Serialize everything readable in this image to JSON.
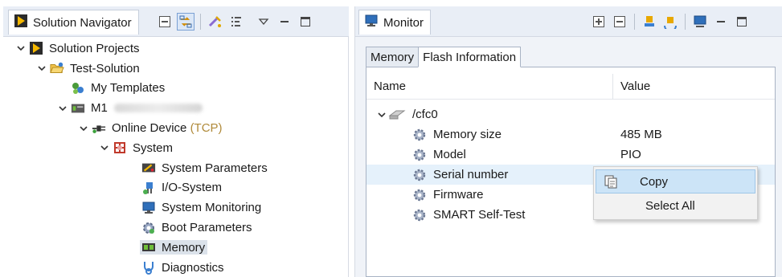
{
  "navigator": {
    "tab_label": "Solution Navigator",
    "toolbar": [
      "collapse-all-icon",
      "link-with-editor-icon",
      "filter-icon",
      "list-view-icon",
      "view-menu-icon",
      "minimize-icon",
      "maximize-icon"
    ],
    "tree": [
      {
        "label": "Solution Projects",
        "suffix": "",
        "icon": "solution-projects-icon",
        "level": 0,
        "expanded": true
      },
      {
        "label": "Test-Solution",
        "suffix": "",
        "icon": "folder-open-icon",
        "level": 1,
        "expanded": true
      },
      {
        "label": "My Templates",
        "suffix": "",
        "icon": "templates-icon",
        "level": 2,
        "expanded": null
      },
      {
        "label": "M1",
        "suffix": "",
        "icon": "device-module-icon",
        "level": 2,
        "expanded": true
      },
      {
        "label": "Online Device",
        "suffix": "(TCP)",
        "icon": "online-device-icon",
        "level": 3,
        "expanded": true
      },
      {
        "label": "System",
        "suffix": "",
        "icon": "system-icon",
        "level": 4,
        "expanded": true
      },
      {
        "label": "System Parameters",
        "suffix": "",
        "icon": "system-parameters-icon",
        "level": 5,
        "expanded": null
      },
      {
        "label": "I/O-System",
        "suffix": "",
        "icon": "io-system-icon",
        "level": 5,
        "expanded": null
      },
      {
        "label": "System Monitoring",
        "suffix": "",
        "icon": "monitor-icon",
        "level": 5,
        "expanded": null
      },
      {
        "label": "Boot Parameters",
        "suffix": "",
        "icon": "boot-gear-icon",
        "level": 5,
        "expanded": null
      },
      {
        "label": "Memory",
        "suffix": "",
        "icon": "memory-chip-icon",
        "level": 5,
        "expanded": null,
        "selected": true
      },
      {
        "label": "Diagnostics",
        "suffix": "",
        "icon": "diagnostics-icon",
        "level": 5,
        "expanded": null
      }
    ]
  },
  "monitor": {
    "tab_label": "Monitor",
    "toolbar": [
      "expand-all-icon",
      "collapse-all-icon",
      "connect-icon",
      "refresh-icon",
      "monitor-view-icon",
      "minimize-icon",
      "maximize-icon"
    ],
    "inner_tabs": [
      "Memory",
      "Flash Information"
    ],
    "active_inner_tab": 1,
    "columns": {
      "name": "Name",
      "value": "Value"
    },
    "rows": [
      {
        "name": "/cfc0",
        "value": "",
        "icon": "drive-icon",
        "level": 0,
        "expanded": true
      },
      {
        "name": "Memory size",
        "value": "485 MB",
        "icon": "property-gear-icon",
        "level": 1
      },
      {
        "name": "Model",
        "value": "PIO",
        "icon": "property-gear-icon",
        "level": 1
      },
      {
        "name": "Serial number",
        "value": "",
        "icon": "property-gear-icon",
        "level": 1,
        "hover": true,
        "obscured": true
      },
      {
        "name": "Firmware",
        "value": "",
        "icon": "property-gear-icon",
        "level": 1
      },
      {
        "name": "SMART Self-Test",
        "value": "",
        "icon": "property-gear-icon",
        "level": 1
      }
    ]
  },
  "context_menu": {
    "items": [
      {
        "label": "Copy",
        "icon": "copy-icon",
        "highlighted": true
      },
      {
        "label": "Select All",
        "icon": "",
        "highlighted": false
      }
    ]
  },
  "colors": {
    "header_bg": "#e9eef6",
    "selection": "#dbe2ea",
    "row_hover": "#e5f1fb",
    "menu_highlight": "#cce4f7",
    "suffix": "#b08a3a"
  }
}
